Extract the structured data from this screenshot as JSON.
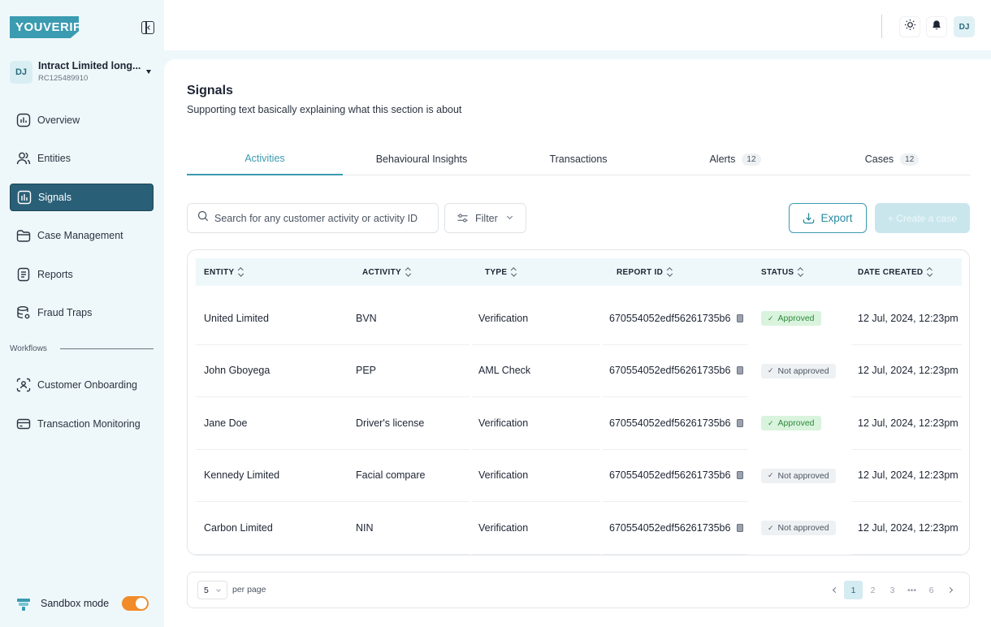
{
  "brand": {
    "logo_text": "YOUVERIFY",
    "accent": "#3b9bb0",
    "active_nav": "#2a6077"
  },
  "org": {
    "avatar": "DJ",
    "name": "Intract Limited long...",
    "rc": "RC125489910"
  },
  "nav": {
    "items": [
      {
        "label": "Overview",
        "icon": "chart-box-icon"
      },
      {
        "label": "Entities",
        "icon": "users-icon"
      },
      {
        "label": "Signals",
        "icon": "signal-bars-icon",
        "active": true
      },
      {
        "label": "Case Management",
        "icon": "folder-icon"
      },
      {
        "label": "Reports",
        "icon": "document-icon"
      },
      {
        "label": "Fraud Traps",
        "icon": "database-gear-icon"
      }
    ],
    "workflows_label": "Workflows",
    "workflow_items": [
      {
        "label": "Customer Onboarding",
        "icon": "face-scan-icon"
      },
      {
        "label": "Transaction Monitoring",
        "icon": "card-icon"
      }
    ]
  },
  "sandbox": {
    "label": "Sandbox mode",
    "enabled": true,
    "toggle_color": "#f28c2a"
  },
  "header": {
    "user_avatar": "DJ"
  },
  "page": {
    "title": "Signals",
    "subtitle": "Supporting text basically explaining what this section is about"
  },
  "tabs": [
    {
      "label": "Activities",
      "active": true,
      "count": ""
    },
    {
      "label": "Behavioural Insights",
      "count": ""
    },
    {
      "label": "Transactions",
      "count": ""
    },
    {
      "label": "Alerts",
      "count": "12"
    },
    {
      "label": "Cases",
      "count": "12"
    }
  ],
  "toolbar": {
    "search_placeholder": "Search for any customer activity or activity ID",
    "filter_label": "Filter",
    "export_label": "Export",
    "create_label": "+ Create a case"
  },
  "table": {
    "columns": [
      "ENTITY",
      "ACTIVITY",
      "TYPE",
      "REPORT ID",
      "STATUS",
      "DATE CREATED"
    ],
    "rows": [
      {
        "entity": "United Limited",
        "activity": "BVN",
        "type": "Verification",
        "report_id": "670554052edf56261735b6",
        "status": "Approved",
        "approved": true,
        "date": "12 Jul, 2024, 12:23pm"
      },
      {
        "entity": "John Gboyega",
        "activity": "PEP",
        "type": "AML Check",
        "report_id": "670554052edf56261735b6",
        "status": "Not approved",
        "approved": false,
        "date": "12 Jul, 2024, 12:23pm"
      },
      {
        "entity": "Jane Doe",
        "activity": "Driver's license",
        "type": "Verification",
        "report_id": "670554052edf56261735b6",
        "status": "Approved",
        "approved": true,
        "date": "12 Jul, 2024, 12:23pm"
      },
      {
        "entity": "Kennedy Limited",
        "activity": "Facial compare",
        "type": "Verification",
        "report_id": "670554052edf56261735b6",
        "status": "Not approved",
        "approved": false,
        "date": "12 Jul, 2024, 12:23pm"
      },
      {
        "entity": "Carbon Limited",
        "activity": "NIN",
        "type": "Verification",
        "report_id": "670554052edf56261735b6",
        "status": "Not approved",
        "approved": false,
        "date": "12 Jul, 2024, 12:23pm"
      }
    ]
  },
  "pagination": {
    "per_page_value": "5",
    "per_page_label": "per page",
    "pages": [
      "1",
      "2",
      "3",
      "•••",
      "6"
    ],
    "current": "1"
  }
}
